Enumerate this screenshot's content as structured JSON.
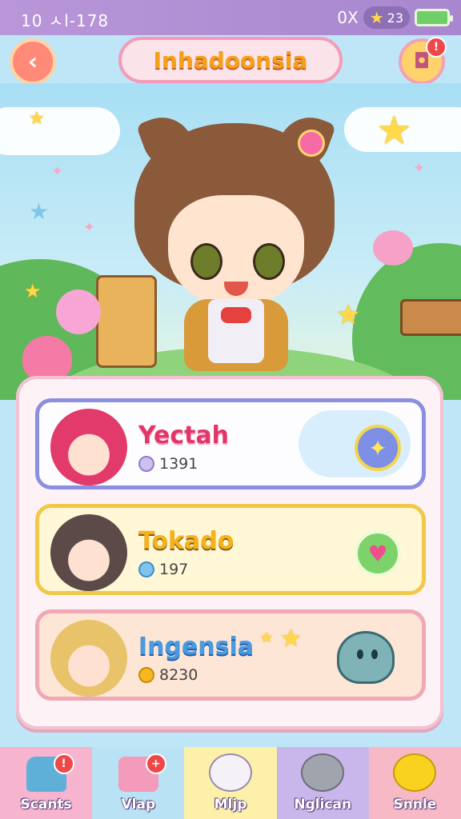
{
  "status_bar": {
    "time": "10 ㅅl-178",
    "currency_prefix": "0X",
    "currency_value": "23",
    "icons": {
      "currency": "star-icon",
      "battery": "battery-icon"
    }
  },
  "header": {
    "title": "Inhadoonsia",
    "back_icon": "back-arrow-icon",
    "shop_icon": "shop-bag-icon",
    "shop_badge": "!"
  },
  "characters": [
    {
      "name": "Yectah",
      "score": "1391",
      "action_icon": "plus-icon",
      "coin_color": "#cdbff0"
    },
    {
      "name": "Tokado",
      "score": "197",
      "action_icon": "heart-ticket-icon",
      "coin_color": "#7fc3ee"
    },
    {
      "name": "Ingensia",
      "score": "8230",
      "action_icon": "slime-icon",
      "coin_color": "#f6b81f"
    }
  ],
  "tabs": [
    {
      "label": "Scants",
      "icon": "house-icon",
      "badge": "!",
      "bg": "#f6b4cf"
    },
    {
      "label": "Vlap",
      "icon": "map-icon",
      "badge": "+",
      "bg": "#b9e3f4"
    },
    {
      "label": "Mljp",
      "icon": "cat-icon",
      "badge": "",
      "bg": "#fdf0a8"
    },
    {
      "label": "Nglican",
      "icon": "gray-cat-icon",
      "badge": "",
      "bg": "#c9b6ea"
    },
    {
      "label": "Snnle",
      "icon": "chick-icon",
      "badge": "",
      "bg": "#f7b9c6"
    }
  ],
  "colors": {
    "accent_pink": "#f59ab8",
    "title_orange": "#f4a019",
    "panel_bg": "#fdf3f6"
  }
}
